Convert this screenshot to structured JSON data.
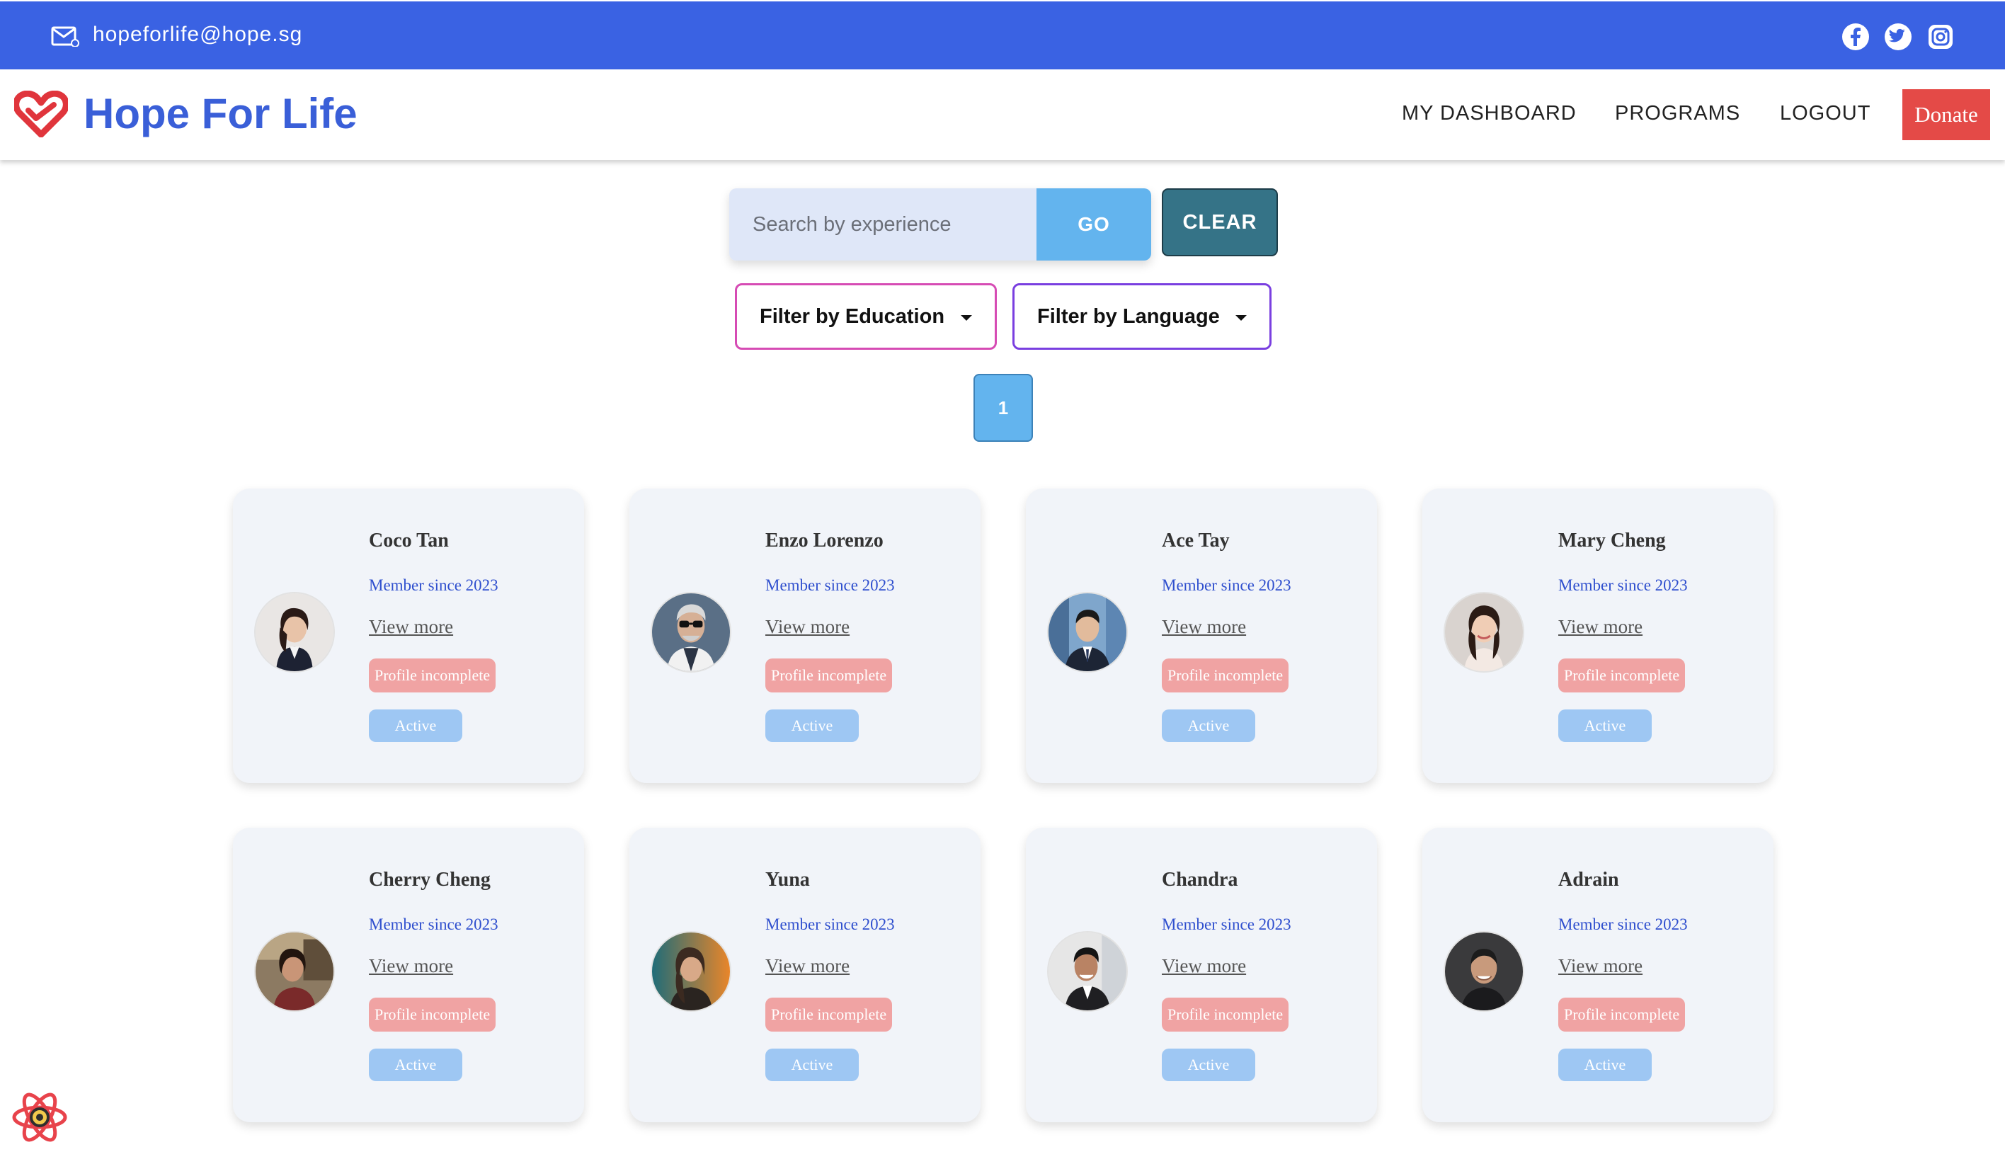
{
  "topbar": {
    "email": "hopeforlife@hope.sg",
    "email_icon": "mail-icon",
    "social_icons": [
      "facebook-icon",
      "twitter-icon",
      "instagram-icon"
    ],
    "color": "#3a62e3"
  },
  "navbar": {
    "brand": "Hope For Life",
    "logo_icon": "heart-icon",
    "links": [
      "MY DASHBOARD",
      "PROGRAMS",
      "LOGOUT"
    ],
    "donate_label": "Donate",
    "donate_color": "#e44a47"
  },
  "search": {
    "placeholder": "Search by experience",
    "value": "",
    "go_label": "GO",
    "clear_label": "CLEAR"
  },
  "filters": {
    "education_label": "Filter by Education",
    "language_label": "Filter by Language"
  },
  "pagination": {
    "current_page": "1"
  },
  "cards": [
    {
      "name": "Coco Tan",
      "since": "Member since 2023",
      "view_more": "View more",
      "status_profile": "Profile incomplete",
      "status_active": "Active"
    },
    {
      "name": "Enzo Lorenzo",
      "since": "Member since 2023",
      "view_more": "View more",
      "status_profile": "Profile incomplete",
      "status_active": "Active"
    },
    {
      "name": "Ace Tay",
      "since": "Member since 2023",
      "view_more": "View more",
      "status_profile": "Profile incomplete",
      "status_active": "Active"
    },
    {
      "name": "Mary Cheng",
      "since": "Member since 2023",
      "view_more": "View more",
      "status_profile": "Profile incomplete",
      "status_active": "Active"
    },
    {
      "name": "Cherry Cheng",
      "since": "Member since 2023",
      "view_more": "View more",
      "status_profile": "Profile incomplete",
      "status_active": "Active"
    },
    {
      "name": "Yuna",
      "since": "Member since 2023",
      "view_more": "View more",
      "status_profile": "Profile incomplete",
      "status_active": "Active"
    },
    {
      "name": "Chandra",
      "since": "Member since 2023",
      "view_more": "View more",
      "status_profile": "Profile incomplete",
      "status_active": "Active"
    },
    {
      "name": "Adrain",
      "since": "Member since 2023",
      "view_more": "View more",
      "status_profile": "Profile incomplete",
      "status_active": "Active"
    }
  ],
  "devtools_icon": "react-icon"
}
